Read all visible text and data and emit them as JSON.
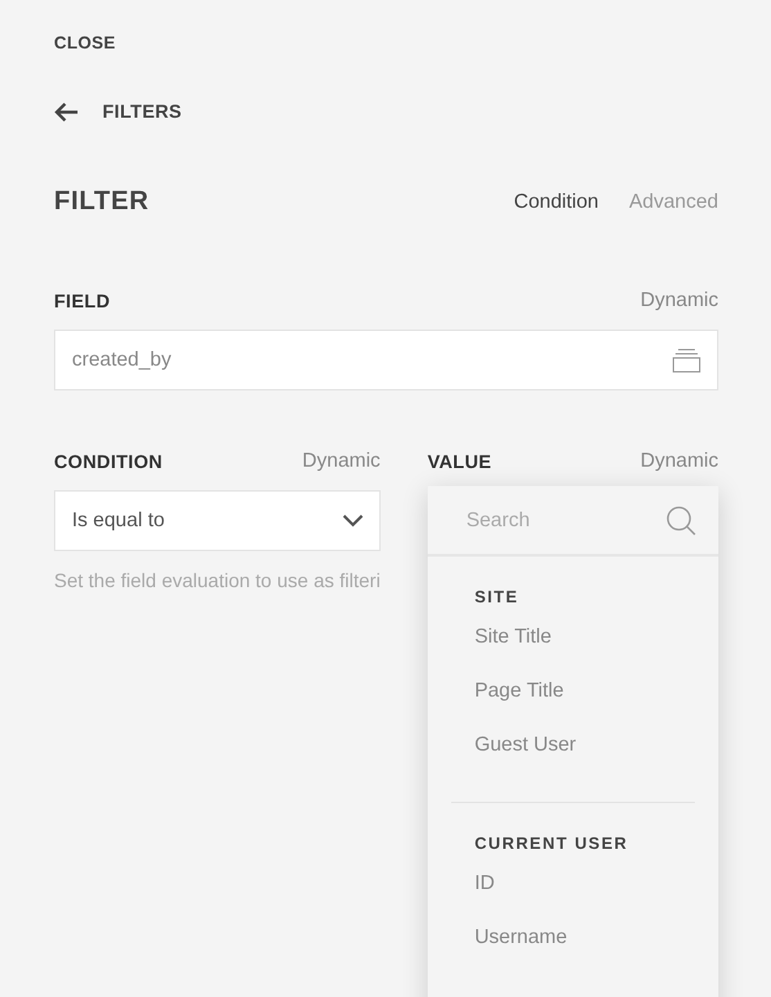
{
  "close_link": "CLOSE",
  "breadcrumb": {
    "label": "FILTERS"
  },
  "title": "FILTER",
  "tabs": [
    {
      "label": "Condition",
      "selected": true
    },
    {
      "label": "Advanced",
      "selected": false
    }
  ],
  "field": {
    "label": "FIELD",
    "dynamic": "Dynamic",
    "value": "created_by"
  },
  "condition": {
    "label": "CONDITION",
    "dynamic": "Dynamic",
    "value": "Is equal to",
    "help": "Set the field evaluation to use as filteri"
  },
  "value": {
    "label": "VALUE",
    "dynamic": "Dynamic"
  },
  "dropdown": {
    "search": {
      "placeholder": "Search"
    },
    "groups": [
      {
        "heading": "SITE",
        "items": [
          "Site Title",
          "Page Title",
          "Guest User"
        ]
      },
      {
        "heading": "CURRENT USER",
        "items": [
          "ID",
          "Username"
        ]
      }
    ]
  }
}
